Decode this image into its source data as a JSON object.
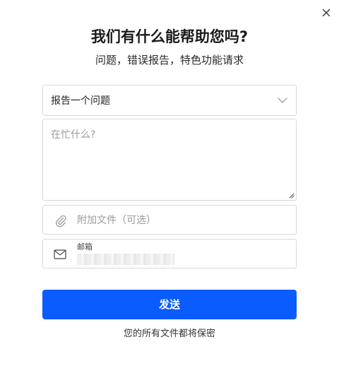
{
  "dialog": {
    "title": "我们有什么能帮助您吗?",
    "subtitle": "问题，错误报告，特色功能请求",
    "close_icon": "close-icon"
  },
  "form": {
    "category": {
      "selected": "报告一个问题",
      "icon": "chevron-down-icon"
    },
    "message": {
      "placeholder": "在忙什么?"
    },
    "attachment": {
      "label": "附加文件（可选）",
      "icon": "paperclip-icon"
    },
    "email": {
      "label": "邮箱",
      "value": "",
      "icon": "mail-icon"
    },
    "submit_label": "发送",
    "privacy_note": "您的所有文件都将保密"
  },
  "colors": {
    "primary": "#0a5cff",
    "border": "#d9d9d9",
    "placeholder": "#9a9a9a"
  }
}
